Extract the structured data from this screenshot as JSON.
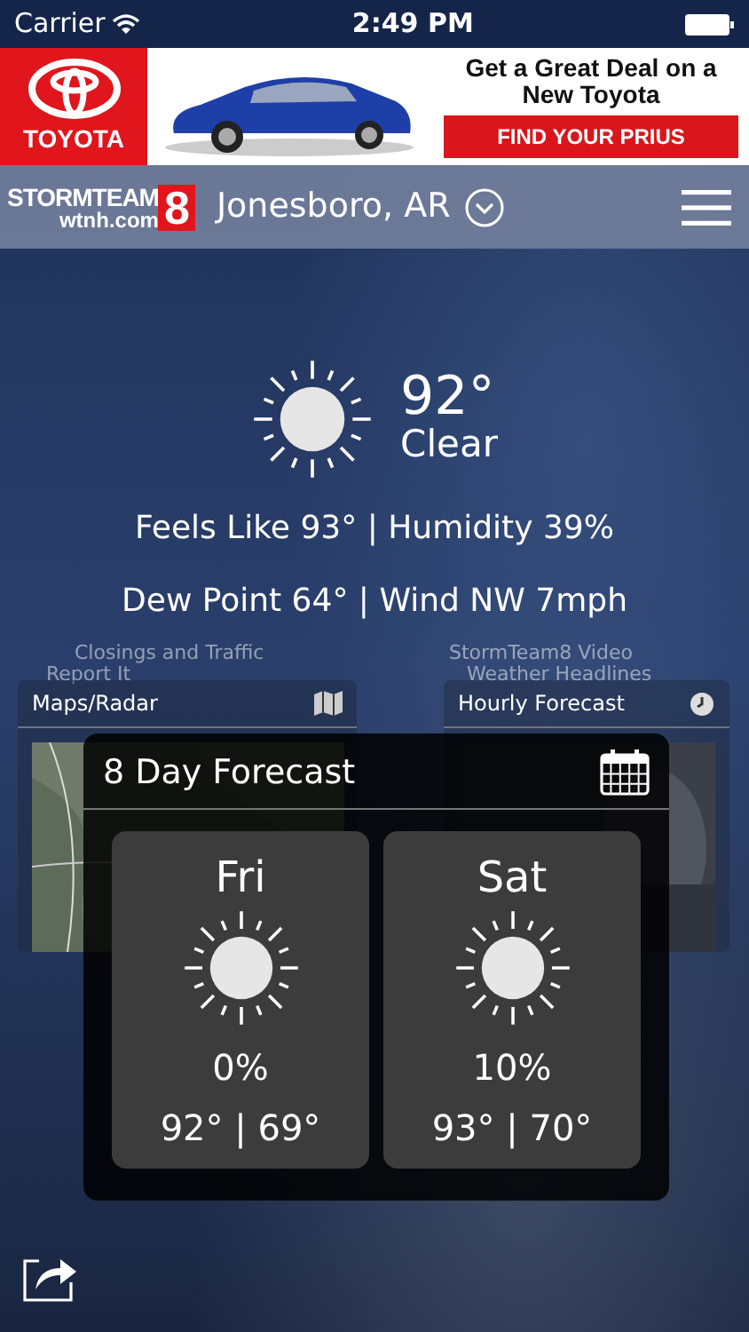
{
  "status_bar": {
    "carrier": "Carrier",
    "time": "2:49 PM"
  },
  "ad": {
    "brand": "TOYOTA",
    "headline": "Get a Great Deal on a New Toyota",
    "button": "FIND YOUR PRIUS"
  },
  "header": {
    "logo_top": "STORMTEAM",
    "logo_bottom": "wtnh.com",
    "logo_number": "8",
    "location": "Jonesboro, AR"
  },
  "current": {
    "temperature": "92°",
    "condition": "Clear",
    "line_1": "Feels Like 93° | Humidity 39%",
    "line_2": "Dew Point 64° | Wind NW 7mph"
  },
  "back_titles": {
    "left": [
      "Closings and Traffic",
      "Report It"
    ],
    "right": [
      "StormTeam8 Video",
      "Weather Headlines"
    ]
  },
  "cards": [
    {
      "title": "Maps/Radar",
      "kind": "map"
    },
    {
      "title": "Hourly Forecast",
      "kind": "hourly"
    }
  ],
  "forecast": {
    "title": "8 Day Forecast",
    "days": [
      {
        "day": "Fri",
        "precip": "0%",
        "temps": "92° | 69°"
      },
      {
        "day": "Sat",
        "precip": "10%",
        "temps": "93° | 70°"
      }
    ]
  }
}
